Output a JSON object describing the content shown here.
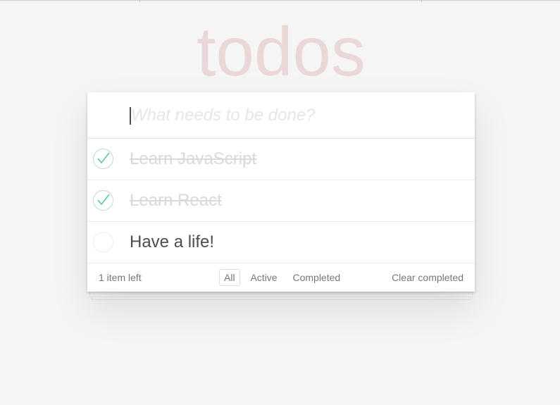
{
  "header": {
    "title": "todos"
  },
  "new_todo": {
    "placeholder": "What needs to be done?",
    "value": ""
  },
  "todos": [
    {
      "label": "Learn JavaScript",
      "completed": true
    },
    {
      "label": "Learn React",
      "completed": true
    },
    {
      "label": "Have a life!",
      "completed": false
    }
  ],
  "footer": {
    "count_text": "1 item left",
    "filters": [
      {
        "label": "All",
        "selected": true
      },
      {
        "label": "Active",
        "selected": false
      },
      {
        "label": "Completed",
        "selected": false
      }
    ],
    "clear_label": "Clear completed"
  },
  "colors": {
    "background": "#f5f5f5",
    "title": "#e9d9d9",
    "check": "#5dc2af",
    "completed_text": "#d9d9d9"
  },
  "icons": {
    "check": "check-icon"
  }
}
